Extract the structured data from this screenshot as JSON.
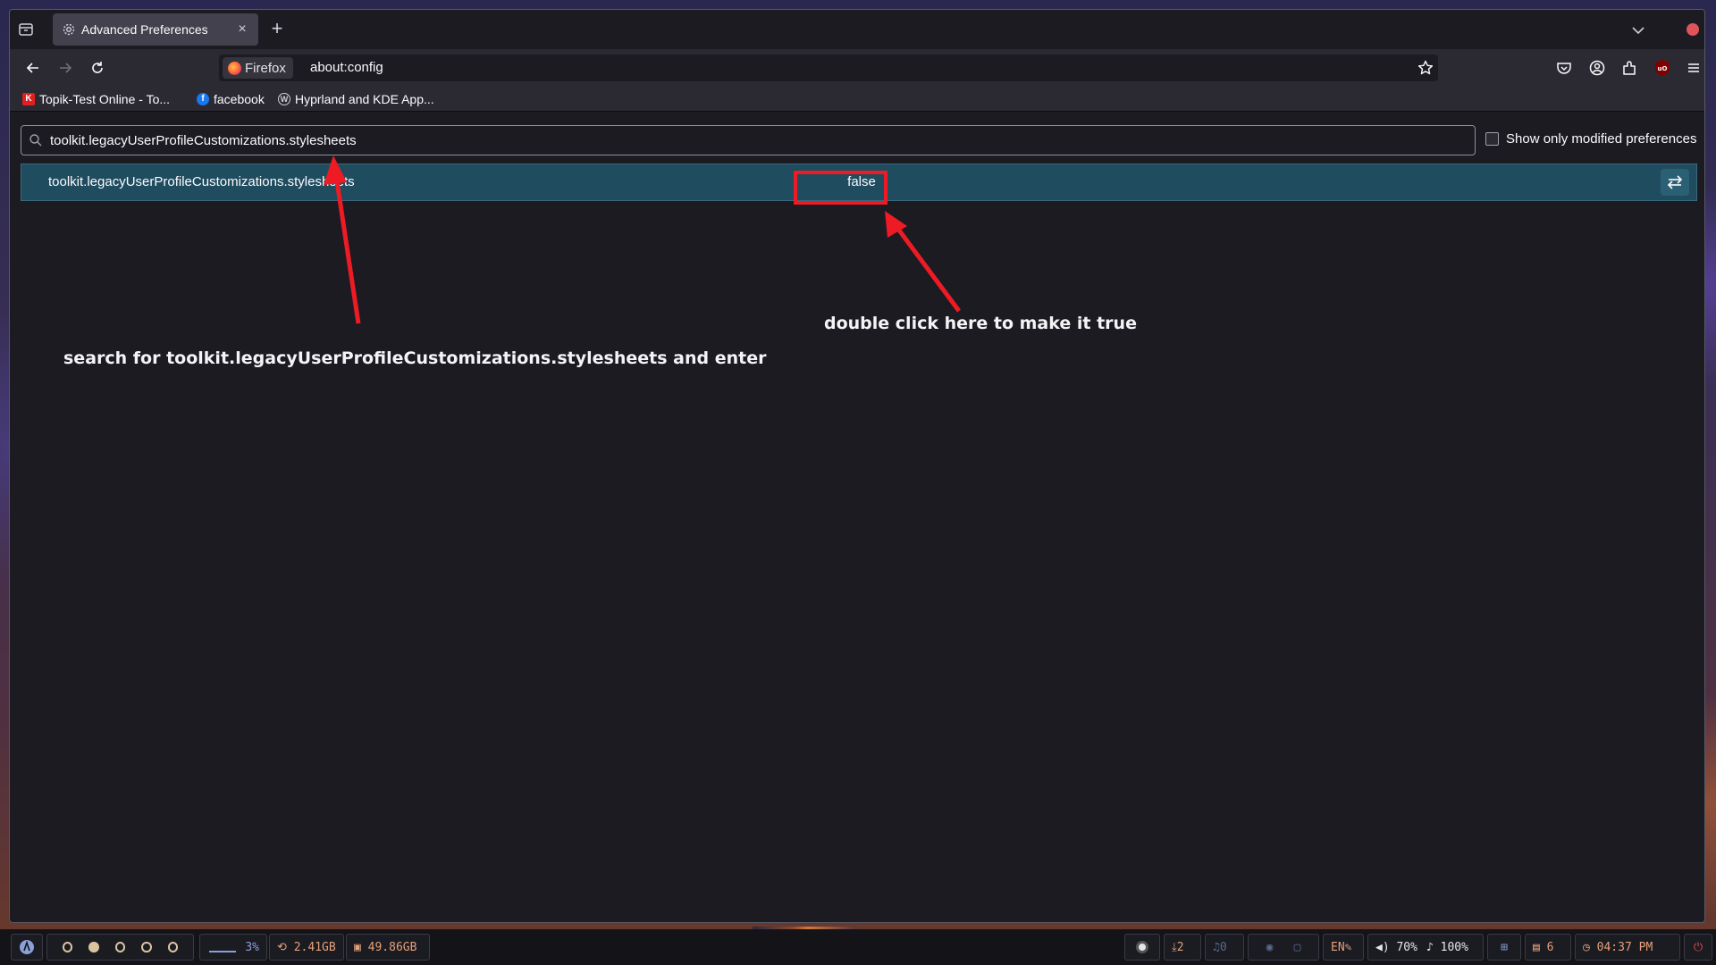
{
  "browser": {
    "tab": {
      "title": "Advanced Preferences"
    },
    "identity_label": "Firefox",
    "url": "about:config"
  },
  "bookmarks": [
    {
      "label": "Topik-Test Online - To...",
      "icon": "k-favicon",
      "color": "#e02020",
      "letter": "K"
    },
    {
      "label": "facebook",
      "icon": "facebook-favicon",
      "color": "#1877f2",
      "letter": "f"
    },
    {
      "label": "Hyprland and KDE App...",
      "icon": "wordpress-favicon",
      "color": "#ffffff",
      "letter": "W"
    }
  ],
  "config": {
    "search_value": "toolkit.legacyUserProfileCustomizations.stylesheets",
    "modified_only_label": "Show only modified preferences",
    "modified_only_checked": false,
    "pref": {
      "name": "toolkit.legacyUserProfileCustomizations.stylesheets",
      "value": "false"
    }
  },
  "annotations": {
    "search_note": "search for toolkit.legacyUserProfileCustomizations.stylesheets and enter",
    "value_note": "double click here to make it true",
    "color": "#ee1b24"
  },
  "taskbar": {
    "cpu": "3%",
    "memory": "2.41GB",
    "disk": "49.86GB",
    "updates": "2",
    "notifications": "0",
    "keyboard": "EN",
    "volume": "70%",
    "mic": "100%",
    "clipboard": "6",
    "clock": "04:37 PM"
  }
}
